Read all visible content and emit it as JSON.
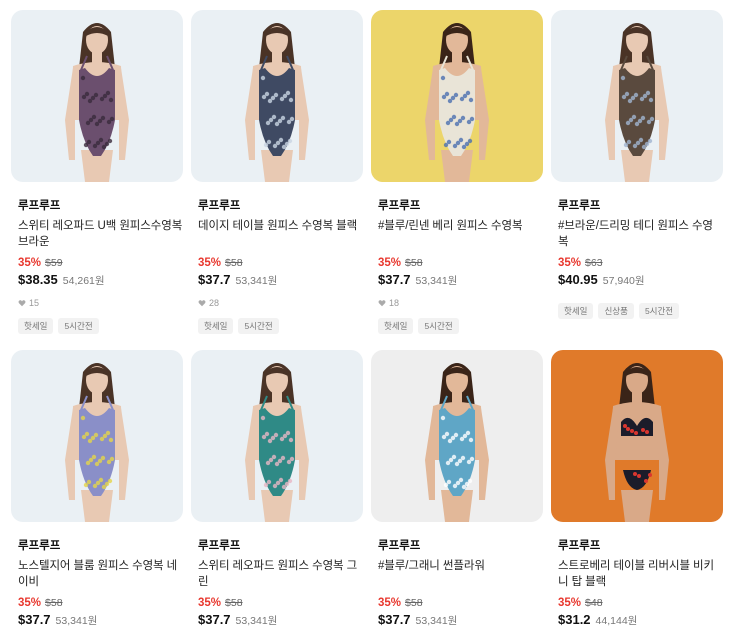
{
  "products": [
    {
      "brand": "루프루프",
      "title": "스위티 레오파드 U백 원피스수영복 브라운",
      "discount": "35%",
      "original_price": "$59",
      "price_usd": "$38.35",
      "price_krw": "54,261원",
      "likes": "15",
      "tags": [
        "핫세일",
        "5시간전"
      ],
      "bg": "#eaf0f4",
      "suit": "#6b4f6e",
      "pattern": "#3a2a3c",
      "skin": "#e8c9b3",
      "hair": "#4a3326"
    },
    {
      "brand": "루프루프",
      "title": "데이지 테이블 원피스 수영복 블랙",
      "discount": "35%",
      "original_price": "$58",
      "price_usd": "$37.7",
      "price_krw": "53,341원",
      "likes": "28",
      "tags": [
        "핫세일",
        "5시간전"
      ],
      "bg": "#eaf0f4",
      "suit": "#3f4a63",
      "pattern": "#c9d4e2",
      "skin": "#e8c9b3",
      "hair": "#4a3326"
    },
    {
      "brand": "루프루프",
      "title": "#블루/린넨 베리 원피스 수영복",
      "discount": "35%",
      "original_price": "$58",
      "price_usd": "$37.7",
      "price_krw": "53,341원",
      "likes": "18",
      "tags": [
        "핫세일",
        "5시간전"
      ],
      "bg": "#ecd56a",
      "suit": "#e9e4d7",
      "pattern": "#4b6fb0",
      "skin": "#e2b899",
      "hair": "#3a2418"
    },
    {
      "brand": "루프루프",
      "title": "#브라운/드리밍 테디 원피스 수영복",
      "discount": "35%",
      "original_price": "$63",
      "price_usd": "$40.95",
      "price_krw": "57,940원",
      "likes": "",
      "tags": [
        "핫세일",
        "신상품",
        "5시간전"
      ],
      "bg": "#eaf0f4",
      "suit": "#5a4a3e",
      "pattern": "#a0b4d0",
      "skin": "#e8c9b3",
      "hair": "#4a3326"
    },
    {
      "brand": "루프루프",
      "title": "노스텔지어 블룸 원피스 수영복 네이비",
      "discount": "35%",
      "original_price": "$58",
      "price_usd": "$37.7",
      "price_krw": "53,341원",
      "likes": "",
      "tags": [],
      "bg": "#eaf0f4",
      "suit": "#8a8fc8",
      "pattern": "#e3d44a",
      "skin": "#e8c9b3",
      "hair": "#4a3326"
    },
    {
      "brand": "루프루프",
      "title": "스위티 레오파드 원피스 수영복 그린",
      "discount": "35%",
      "original_price": "$58",
      "price_usd": "$37.7",
      "price_krw": "53,341원",
      "likes": "",
      "tags": [],
      "bg": "#eaf0f4",
      "suit": "#2f8a86",
      "pattern": "#e7b6c4",
      "skin": "#e8c9b3",
      "hair": "#4a3326"
    },
    {
      "brand": "루프루프",
      "title": "#블루/그래니 썬플라워",
      "discount": "35%",
      "original_price": "$58",
      "price_usd": "$37.7",
      "price_krw": "53,341원",
      "likes": "",
      "tags": [],
      "bg": "#eeeeee",
      "suit": "#5fa6c6",
      "pattern": "#ffffff",
      "skin": "#e2b899",
      "hair": "#3a2418"
    },
    {
      "brand": "루프루프",
      "title": "스트로베리 테이블 리버시블 비키니 탑 블랙",
      "discount": "35%",
      "original_price": "$48",
      "price_usd": "$31.2",
      "price_krw": "44,144원",
      "likes": "",
      "tags": [],
      "bg": "#e07a2a",
      "suit": "#1b1c2a",
      "pattern": "#d9362f",
      "skin": "#d9a988",
      "hair": "#3a2418"
    }
  ]
}
